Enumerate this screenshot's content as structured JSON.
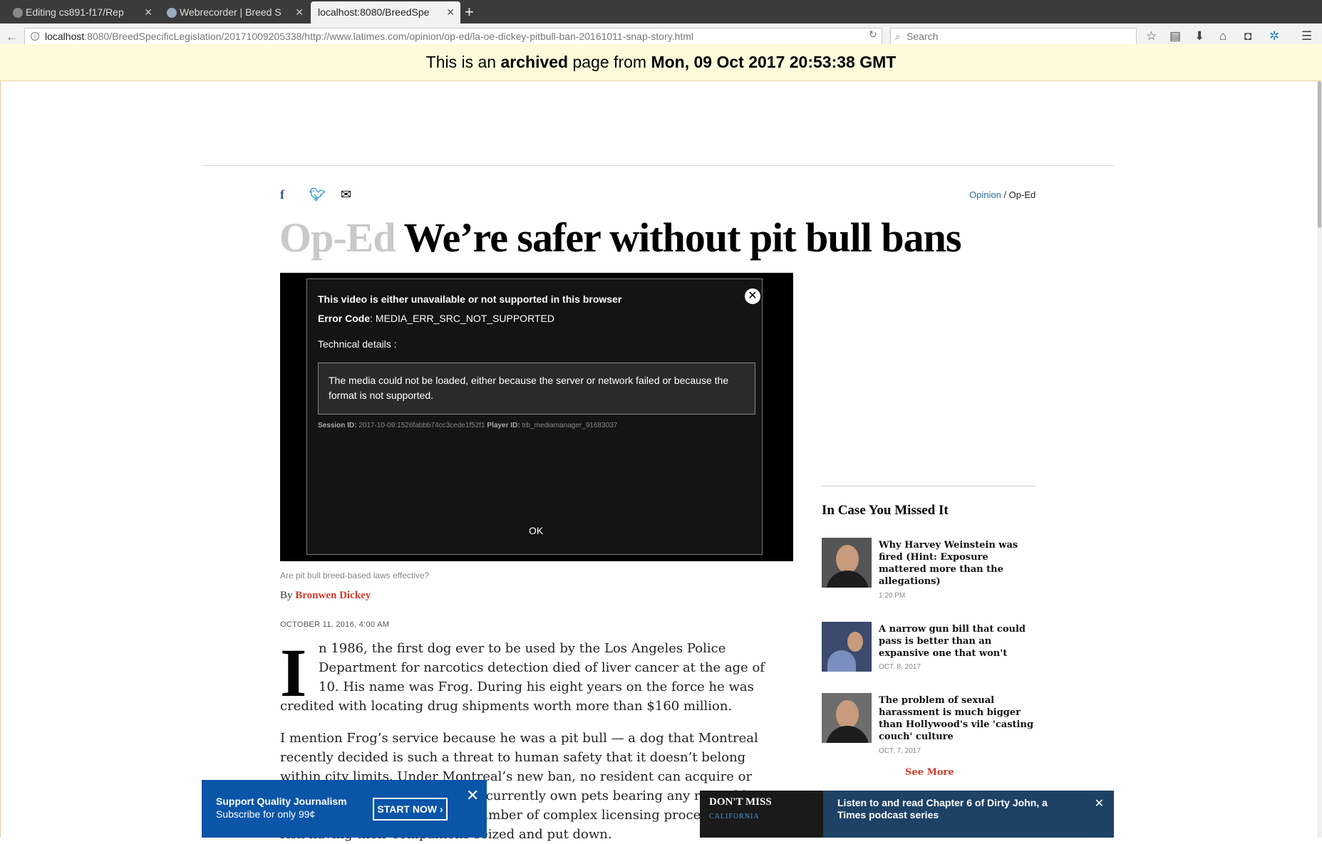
{
  "browser": {
    "tabs": [
      {
        "label": "Editing cs891-f17/Rep"
      },
      {
        "label": "Webrecorder | Breed S"
      },
      {
        "label": "localhost:8080/BreedSpe"
      }
    ],
    "url_host": "localhost",
    "url_rest": ":8080/BreedSpecificLegislation/20171009205338/http://www.latimes.com/opinion/op-ed/la-oe-dickey-pitbull-ban-20161011-snap-story.html",
    "search_placeholder": "Search"
  },
  "archive_banner": {
    "prefix": "This is an ",
    "emph": "archived",
    "mid": " page from ",
    "date": "Mon, 09 Oct 2017 20:53:38 GMT"
  },
  "article": {
    "breadcrumb_section": "Opinion",
    "breadcrumb_sep": " / ",
    "breadcrumb_current": "Op-Ed",
    "kicker": "Op-Ed",
    "title": "We’re safer without pit bull bans",
    "video_error": {
      "title": "This video is either unavailable or not supported in this browser",
      "code_label": "Error Code",
      "code_value": ": MEDIA_ERR_SRC_NOT_SUPPORTED",
      "tech_label": "Technical details :",
      "details": "The media could not be loaded, either because the server or network failed or because the format is not supported.",
      "session_label": "Session ID:",
      "session_value": " 2017-10-09:1526fabbb74cc3cede1f52f1 ",
      "player_label": "Player ID:",
      "player_value": " trb_mediamanager_91683037",
      "ok": "OK"
    },
    "caption": "Are pit bull breed-based laws effective?",
    "by": "By ",
    "author": "Bronwen Dickey",
    "date": "OCTOBER 11, 2016, 4:00 AM",
    "dropcap": "I",
    "p1_first": "n 1986, the first dog ever to be used by the Los Angeles Police Department for narcotics detection died of liver cancer at the age of 10. His name was Frog. During his eight years on the force he was",
    "p1_last": "credited with locating drug shipments worth more than $160 million.",
    "p2": "I mention Frog’s service because he was a pit bull — a dog that Montreal recently decided is such a threat to human safety that it doesn’t belong within city limits. Under Montreal’s new ban, no resident can acquire or adopt a pit bull, and those who currently own pets bearing any resemblance to the breed must navigate a number of complex licensing procedures or risk having their companions seized and put down."
  },
  "sidebar": {
    "title": "In Case You Missed It",
    "stories": [
      {
        "title": "Why Harvey Weinstein was fired (Hint: Exposure mattered more than the allegations)",
        "time": "1:20 PM"
      },
      {
        "title": "A narrow gun bill that could pass is better than an expansive one that won't",
        "time": "OCT. 8, 2017"
      },
      {
        "title": "The problem of sexual harassment is much bigger than Hollywood's vile 'casting couch' culture",
        "time": "OCT. 7, 2017"
      }
    ],
    "see_more": "See More"
  },
  "support_bar": {
    "line1": "Support Quality Journalism",
    "line2": "Subscribe for only 99¢",
    "button": "START NOW ›"
  },
  "dont_miss": {
    "label": "DON'T MISS",
    "category": "CALIFORNIA",
    "text": "Listen to and read Chapter 6 of Dirty John, a Times podcast series"
  }
}
